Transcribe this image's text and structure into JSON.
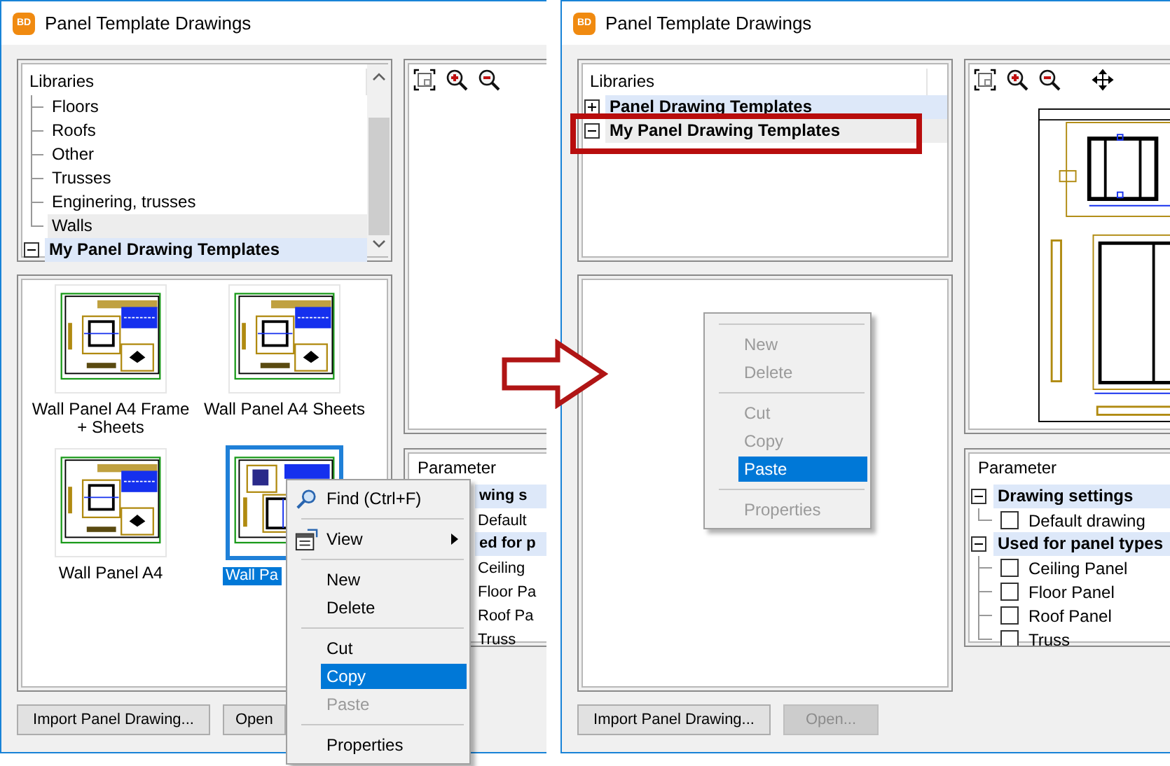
{
  "windows": [
    {
      "app_icon": "BD",
      "title": "Panel Template Drawings",
      "libraries": {
        "header": "Libraries",
        "scrollbar": true,
        "items": [
          {
            "children": [
              {
                "label": "Floors",
                "selected": false,
                "highlighted": false
              },
              {
                "label": "Roofs",
                "selected": false,
                "highlighted": false
              },
              {
                "label": "Other",
                "selected": false,
                "highlighted": false
              },
              {
                "label": "Trusses",
                "selected": false,
                "highlighted": false
              },
              {
                "label": "Enginering, trusses",
                "selected": false,
                "highlighted": false
              },
              {
                "label": "Walls",
                "selected": false,
                "highlighted": true
              }
            ]
          },
          {
            "label": "My Panel Drawing Templates",
            "expanded": true,
            "selected": true,
            "highlighted": false,
            "callout": false
          }
        ]
      },
      "viewer": {
        "tools": [
          {
            "kind": "fit"
          },
          {
            "kind": "zoom-in"
          },
          {
            "kind": "zoom-out"
          }
        ],
        "has_drawing": false
      },
      "thumbnails": [
        {
          "label": "Wall Panel A4 Frame + Sheets",
          "selected": false
        },
        {
          "label": "Wall Panel A4 Sheets",
          "selected": false
        },
        {
          "label": "Wall Panel A4",
          "selected": false
        },
        {
          "label": "Wall Pa",
          "selected": true
        }
      ],
      "parameters": {
        "header": "Parameter",
        "rows": [
          {
            "kind": "group-text",
            "label": "wing s"
          },
          {
            "kind": "option-text",
            "label": "Default"
          },
          {
            "kind": "group-text",
            "label": "ed for p"
          },
          {
            "kind": "option-text",
            "label": "Ceiling"
          },
          {
            "kind": "option-text",
            "label": "Floor Pa"
          },
          {
            "kind": "option-text",
            "label": "Roof Pa"
          },
          {
            "kind": "option-text",
            "label": "Truss"
          }
        ]
      },
      "buttons": [
        {
          "label": "Import Panel Drawing...",
          "disabled": false
        },
        {
          "label": "Open",
          "disabled": false
        }
      ],
      "context_menu": {
        "items": [
          {
            "kind": "find",
            "label": "Find (Ctrl+F)",
            "disabled": false,
            "selected": false
          },
          {
            "kind": "separator"
          },
          {
            "kind": "view",
            "label": "View",
            "disabled": false,
            "selected": false,
            "submenu": true
          },
          {
            "kind": "separator"
          },
          {
            "kind": "item",
            "label": "New",
            "disabled": false,
            "selected": false
          },
          {
            "kind": "item",
            "label": "Delete",
            "disabled": false,
            "selected": false
          },
          {
            "kind": "separator"
          },
          {
            "kind": "item",
            "label": "Cut",
            "disabled": false,
            "selected": false
          },
          {
            "kind": "item",
            "label": "Copy",
            "disabled": false,
            "selected": true
          },
          {
            "kind": "item",
            "label": "Paste",
            "disabled": true,
            "selected": false
          },
          {
            "kind": "separator"
          },
          {
            "kind": "item",
            "label": "Properties",
            "disabled": false,
            "selected": false
          }
        ]
      }
    },
    {
      "app_icon": "BD",
      "title": "Panel Template Drawings",
      "libraries": {
        "header": "Libraries",
        "scrollbar": false,
        "items": [
          {
            "label": "Panel Drawing Templates",
            "expanded": false,
            "selected": true,
            "highlighted": false,
            "callout": false
          },
          {
            "label": "My Panel Drawing Templates",
            "expanded": true,
            "selected": false,
            "highlighted": true,
            "callout": true
          }
        ]
      },
      "viewer": {
        "tools": [
          {
            "kind": "fit"
          },
          {
            "kind": "zoom-in"
          },
          {
            "kind": "zoom-out"
          },
          {
            "kind": "move"
          }
        ],
        "has_drawing": true
      },
      "parameters": {
        "header": "Parameter",
        "rows": [
          {
            "kind": "group",
            "label": "Drawing settings",
            "expanded": true
          },
          {
            "kind": "option",
            "label": "Default drawing",
            "checked": false
          },
          {
            "kind": "group",
            "label": "Used for panel types",
            "expanded": true
          },
          {
            "kind": "option",
            "label": "Ceiling Panel",
            "checked": false
          },
          {
            "kind": "option",
            "label": "Floor Panel",
            "checked": false
          },
          {
            "kind": "option",
            "label": "Roof Panel",
            "checked": false
          },
          {
            "kind": "option",
            "label": "Truss",
            "checked": false
          }
        ]
      },
      "buttons": [
        {
          "label": "Import Panel Drawing...",
          "disabled": false
        },
        {
          "label": "Open...",
          "disabled": true
        }
      ],
      "context_menu": {
        "items": [
          {
            "kind": "separator"
          },
          {
            "kind": "item",
            "label": "New",
            "disabled": true,
            "selected": false
          },
          {
            "kind": "item",
            "label": "Delete",
            "disabled": true,
            "selected": false
          },
          {
            "kind": "separator"
          },
          {
            "kind": "item",
            "label": "Cut",
            "disabled": true,
            "selected": false
          },
          {
            "kind": "item",
            "label": "Copy",
            "disabled": true,
            "selected": false
          },
          {
            "kind": "item",
            "label": "Paste",
            "disabled": false,
            "selected": true
          },
          {
            "kind": "separator"
          },
          {
            "kind": "item",
            "label": "Properties",
            "disabled": true,
            "selected": false
          }
        ]
      }
    }
  ]
}
